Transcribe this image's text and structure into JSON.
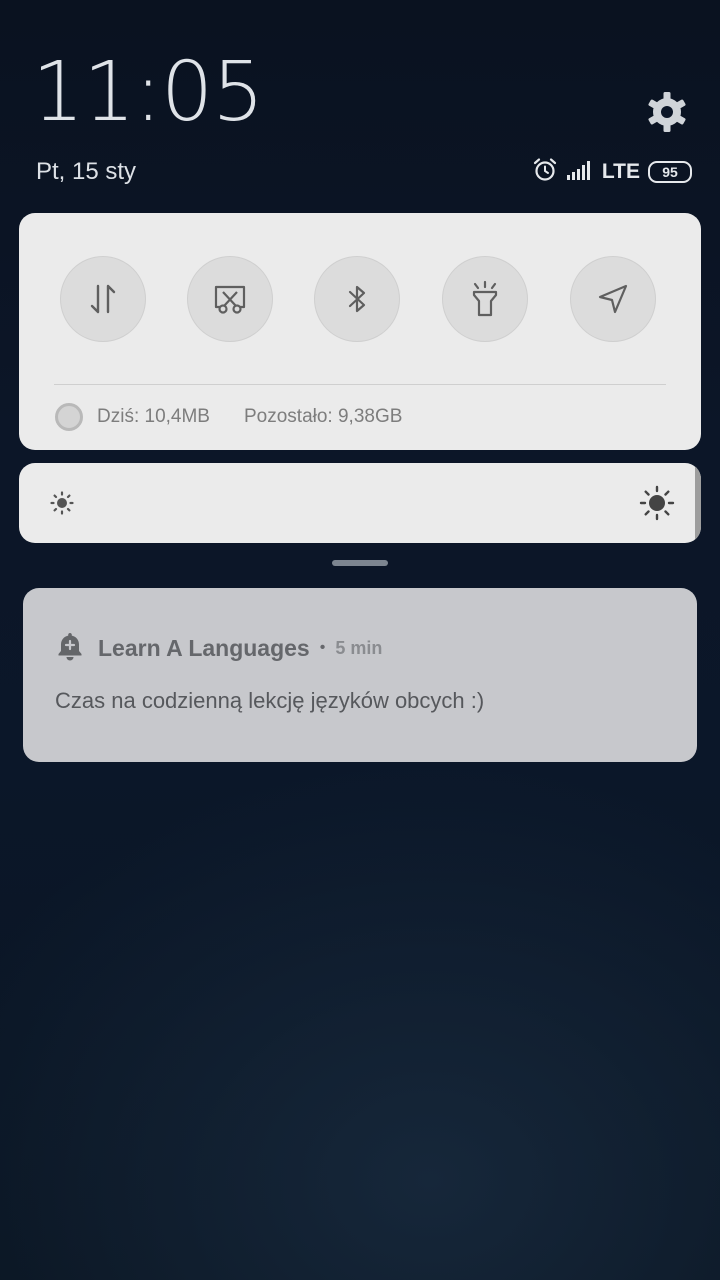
{
  "lockscreen": {
    "time": "11:05",
    "date": "Pt, 15 sty",
    "settings_icon": "gear-icon"
  },
  "status_bar": {
    "alarm_icon": "alarm-clock-icon",
    "signal_icon": "cellular-signal-icon",
    "network": "LTE",
    "battery_level": "95"
  },
  "quick_settings": {
    "toggles": [
      {
        "name": "mobile-data",
        "icon": "data-transfer-arrows-icon"
      },
      {
        "name": "screenshot",
        "icon": "scissors-screenshot-icon"
      },
      {
        "name": "bluetooth",
        "icon": "bluetooth-icon"
      },
      {
        "name": "flashlight",
        "icon": "flashlight-icon"
      },
      {
        "name": "location",
        "icon": "location-arrow-icon"
      }
    ],
    "data_usage": {
      "today": "Dziś: 10,4MB",
      "remaining": "Pozostało: 9,38GB"
    }
  },
  "brightness": {
    "low_icon": "brightness-low-icon",
    "high_icon": "brightness-high-icon",
    "level": 0.0
  },
  "notification": {
    "app_icon": "bell-plus-icon",
    "app_name": "Learn A Languages",
    "separator": "•",
    "time": "5 min",
    "message": "Czas na codzienną lekcję języków obcych :)"
  },
  "colors": {
    "panel_bg": "#ebebeb",
    "notification_bg": "#c7c8cc",
    "icon_gray": "#666666"
  }
}
